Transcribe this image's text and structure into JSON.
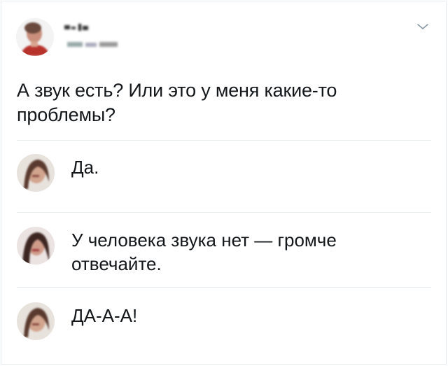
{
  "tweet": {
    "text": "А звук есть? Или это у меня какие-то проблемы?"
  },
  "replies": [
    {
      "text": "Да."
    },
    {
      "text": "У человека звука нет — громче отвечайте."
    },
    {
      "text": "ДА-А-А!"
    }
  ],
  "icons": {
    "menu": "chevron-down-icon"
  }
}
